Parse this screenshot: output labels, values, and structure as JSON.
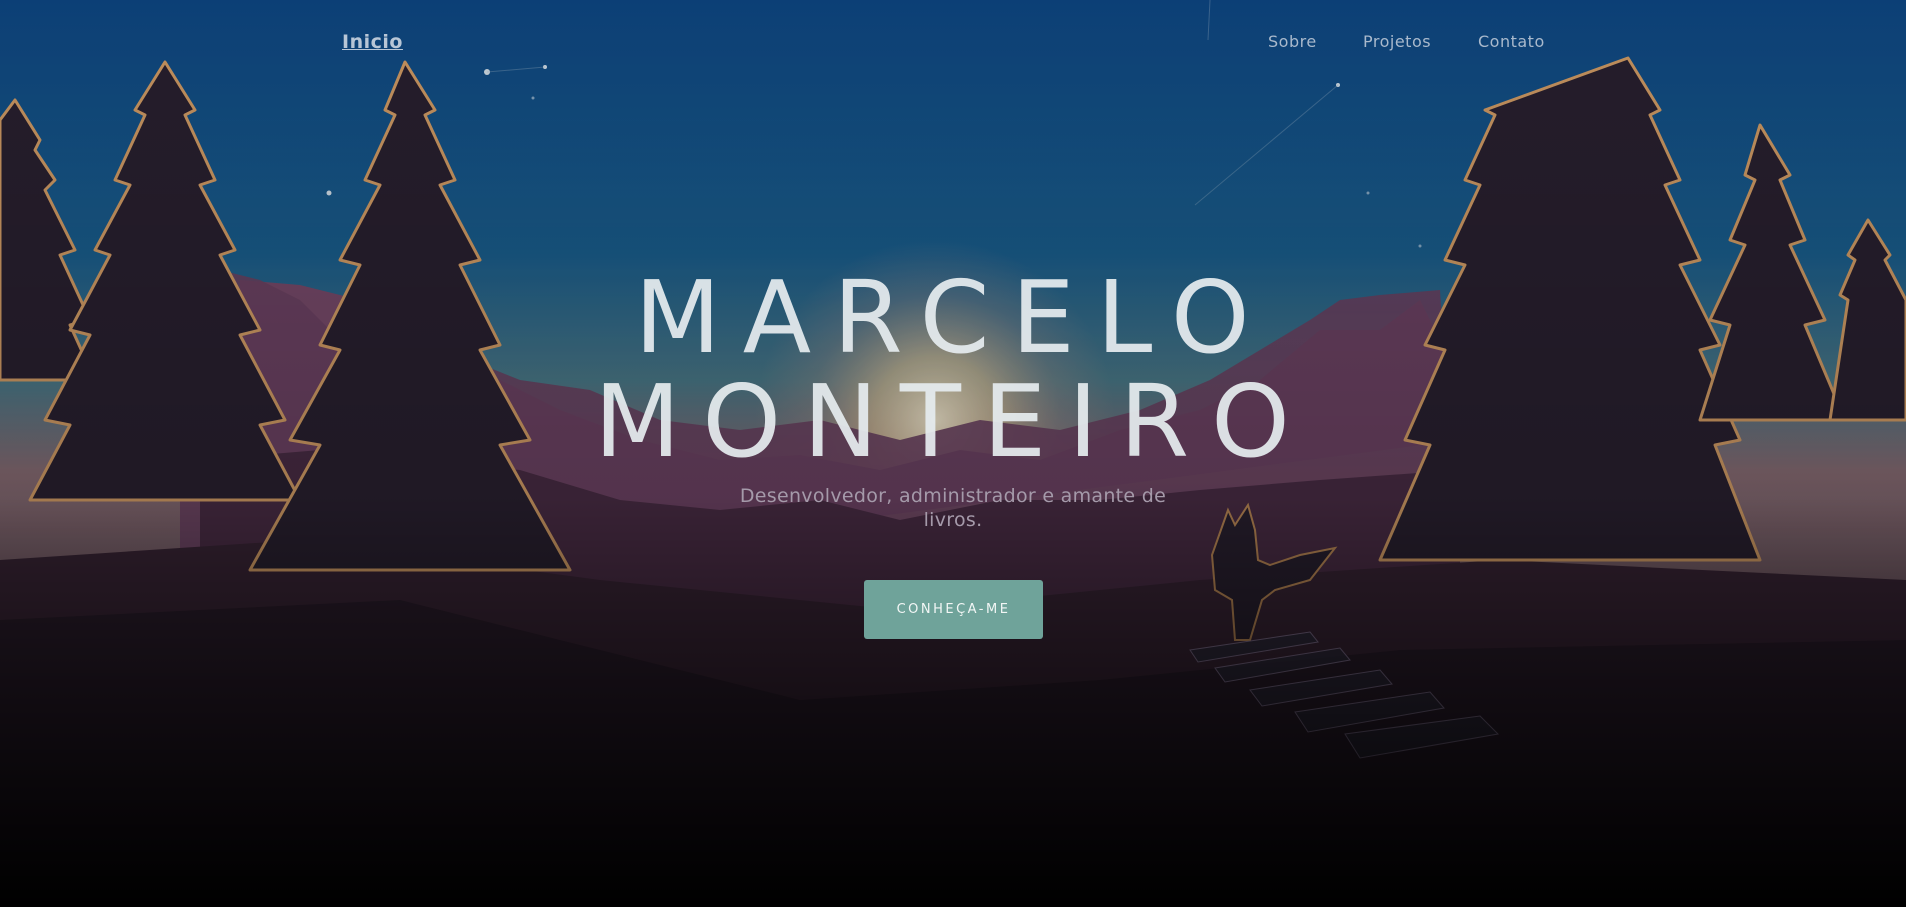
{
  "nav": {
    "brand": "Inicio",
    "links": [
      "Sobre",
      "Projetos",
      "Contato"
    ]
  },
  "hero": {
    "title_line1": "MARCELO",
    "title_line2": "MONTEIRO",
    "subtitle": "Desenvolvedor, administrador e amante de livros.",
    "cta_label": "CONHEÇA-ME"
  },
  "colors": {
    "sky_top": "#0d4683",
    "sky_mid": "#2e6c8e",
    "mountain": "#7a4a6a",
    "tree": "#2a1f2e",
    "tree_edge": "#d9a066",
    "cta": "#6fa39a"
  }
}
